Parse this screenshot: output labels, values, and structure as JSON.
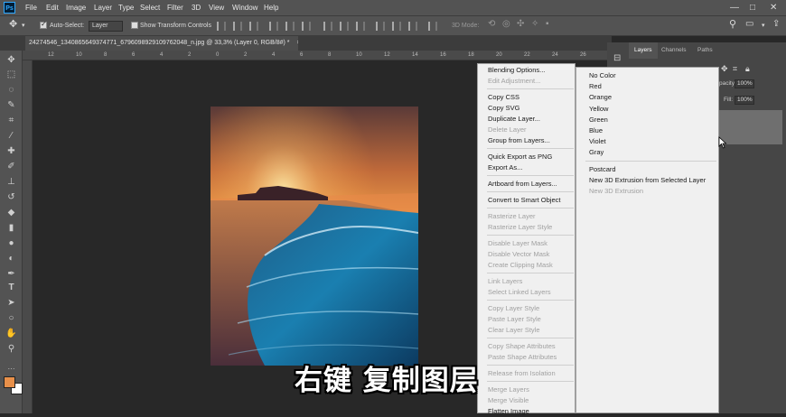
{
  "app": {
    "logo": "Ps"
  },
  "menubar": {
    "items": [
      "File",
      "Edit",
      "Image",
      "Layer",
      "Type",
      "Select",
      "Filter",
      "3D",
      "View",
      "Window",
      "Help"
    ],
    "win_min": "—",
    "win_max": "□",
    "win_close": "✕"
  },
  "options": {
    "auto_select_label": "Auto-Select:",
    "auto_select_value": "Layer",
    "transform_label": "Show Transform Controls",
    "mode_3d": "3D Mode:"
  },
  "document": {
    "tab_title": "24274546_1340865649374771_6796098929109762048_n.jpg @ 33,3% (Layer 0, RGB/8#) *",
    "close": "×"
  },
  "ruler": {
    "ticks": [
      "12",
      "10",
      "8",
      "6",
      "4",
      "2",
      "0",
      "2",
      "4",
      "6",
      "8",
      "10",
      "12",
      "14",
      "16",
      "18",
      "20",
      "22",
      "24",
      "26",
      "28",
      "30"
    ]
  },
  "tools": [
    "move-tool",
    "marquee-tool",
    "lasso-tool",
    "quick-select-tool",
    "crop-tool",
    "eyedropper-tool",
    "healing-tool",
    "brush-tool",
    "clone-tool",
    "history-brush-tool",
    "eraser-tool",
    "gradient-tool",
    "blur-tool",
    "dodge-tool",
    "pen-tool",
    "type-tool",
    "path-select-tool",
    "shape-tool",
    "hand-tool",
    "zoom-tool"
  ],
  "colors": {
    "foreground": "#e8904a",
    "background": "#ffffff"
  },
  "panel": {
    "tabs": [
      "Layers",
      "Channels",
      "Paths"
    ],
    "opacity_label": "pacity:",
    "opacity_value": "100%",
    "fill_label": "Fill:",
    "fill_value": "100%"
  },
  "context_menu": {
    "items": [
      {
        "label": "Blending Options...",
        "disabled": false
      },
      {
        "label": "Edit Adjustment...",
        "disabled": true
      },
      {
        "sep": true
      },
      {
        "label": "Copy CSS",
        "disabled": false
      },
      {
        "label": "Copy SVG",
        "disabled": false
      },
      {
        "label": "Duplicate Layer...",
        "disabled": false
      },
      {
        "label": "Delete Layer",
        "disabled": true
      },
      {
        "label": "Group from Layers...",
        "disabled": false
      },
      {
        "sep": true
      },
      {
        "label": "Quick Export as PNG",
        "disabled": false
      },
      {
        "label": "Export As...",
        "disabled": false
      },
      {
        "sep": true
      },
      {
        "label": "Artboard from Layers...",
        "disabled": false
      },
      {
        "sep": true
      },
      {
        "label": "Convert to Smart Object",
        "disabled": false
      },
      {
        "sep": true
      },
      {
        "label": "Rasterize Layer",
        "disabled": true
      },
      {
        "label": "Rasterize Layer Style",
        "disabled": true
      },
      {
        "sep": true
      },
      {
        "label": "Disable Layer Mask",
        "disabled": true
      },
      {
        "label": "Disable Vector Mask",
        "disabled": true
      },
      {
        "label": "Create Clipping Mask",
        "disabled": true
      },
      {
        "sep": true
      },
      {
        "label": "Link Layers",
        "disabled": true
      },
      {
        "label": "Select Linked Layers",
        "disabled": true
      },
      {
        "sep": true
      },
      {
        "label": "Copy Layer Style",
        "disabled": true
      },
      {
        "label": "Paste Layer Style",
        "disabled": true
      },
      {
        "label": "Clear Layer Style",
        "disabled": true
      },
      {
        "sep": true
      },
      {
        "label": "Copy Shape Attributes",
        "disabled": true
      },
      {
        "label": "Paste Shape Attributes",
        "disabled": true
      },
      {
        "sep": true
      },
      {
        "label": "Release from Isolation",
        "disabled": true
      },
      {
        "sep": true
      },
      {
        "label": "Merge Layers",
        "disabled": true
      },
      {
        "label": "Merge Visible",
        "disabled": true
      },
      {
        "label": "Flatten Image",
        "disabled": false
      }
    ]
  },
  "submenu": {
    "items": [
      {
        "label": "No Color",
        "disabled": false
      },
      {
        "label": "Red",
        "disabled": false
      },
      {
        "label": "Orange",
        "disabled": false
      },
      {
        "label": "Yellow",
        "disabled": false
      },
      {
        "label": "Green",
        "disabled": false
      },
      {
        "label": "Blue",
        "disabled": false
      },
      {
        "label": "Violet",
        "disabled": false
      },
      {
        "label": "Gray",
        "disabled": false
      },
      {
        "sep": true
      },
      {
        "label": "Postcard",
        "disabled": false
      },
      {
        "label": "New 3D Extrusion from Selected Layer",
        "disabled": false
      },
      {
        "label": "New 3D Extrusion",
        "disabled": true
      }
    ]
  },
  "caption": "右键 复制图层"
}
